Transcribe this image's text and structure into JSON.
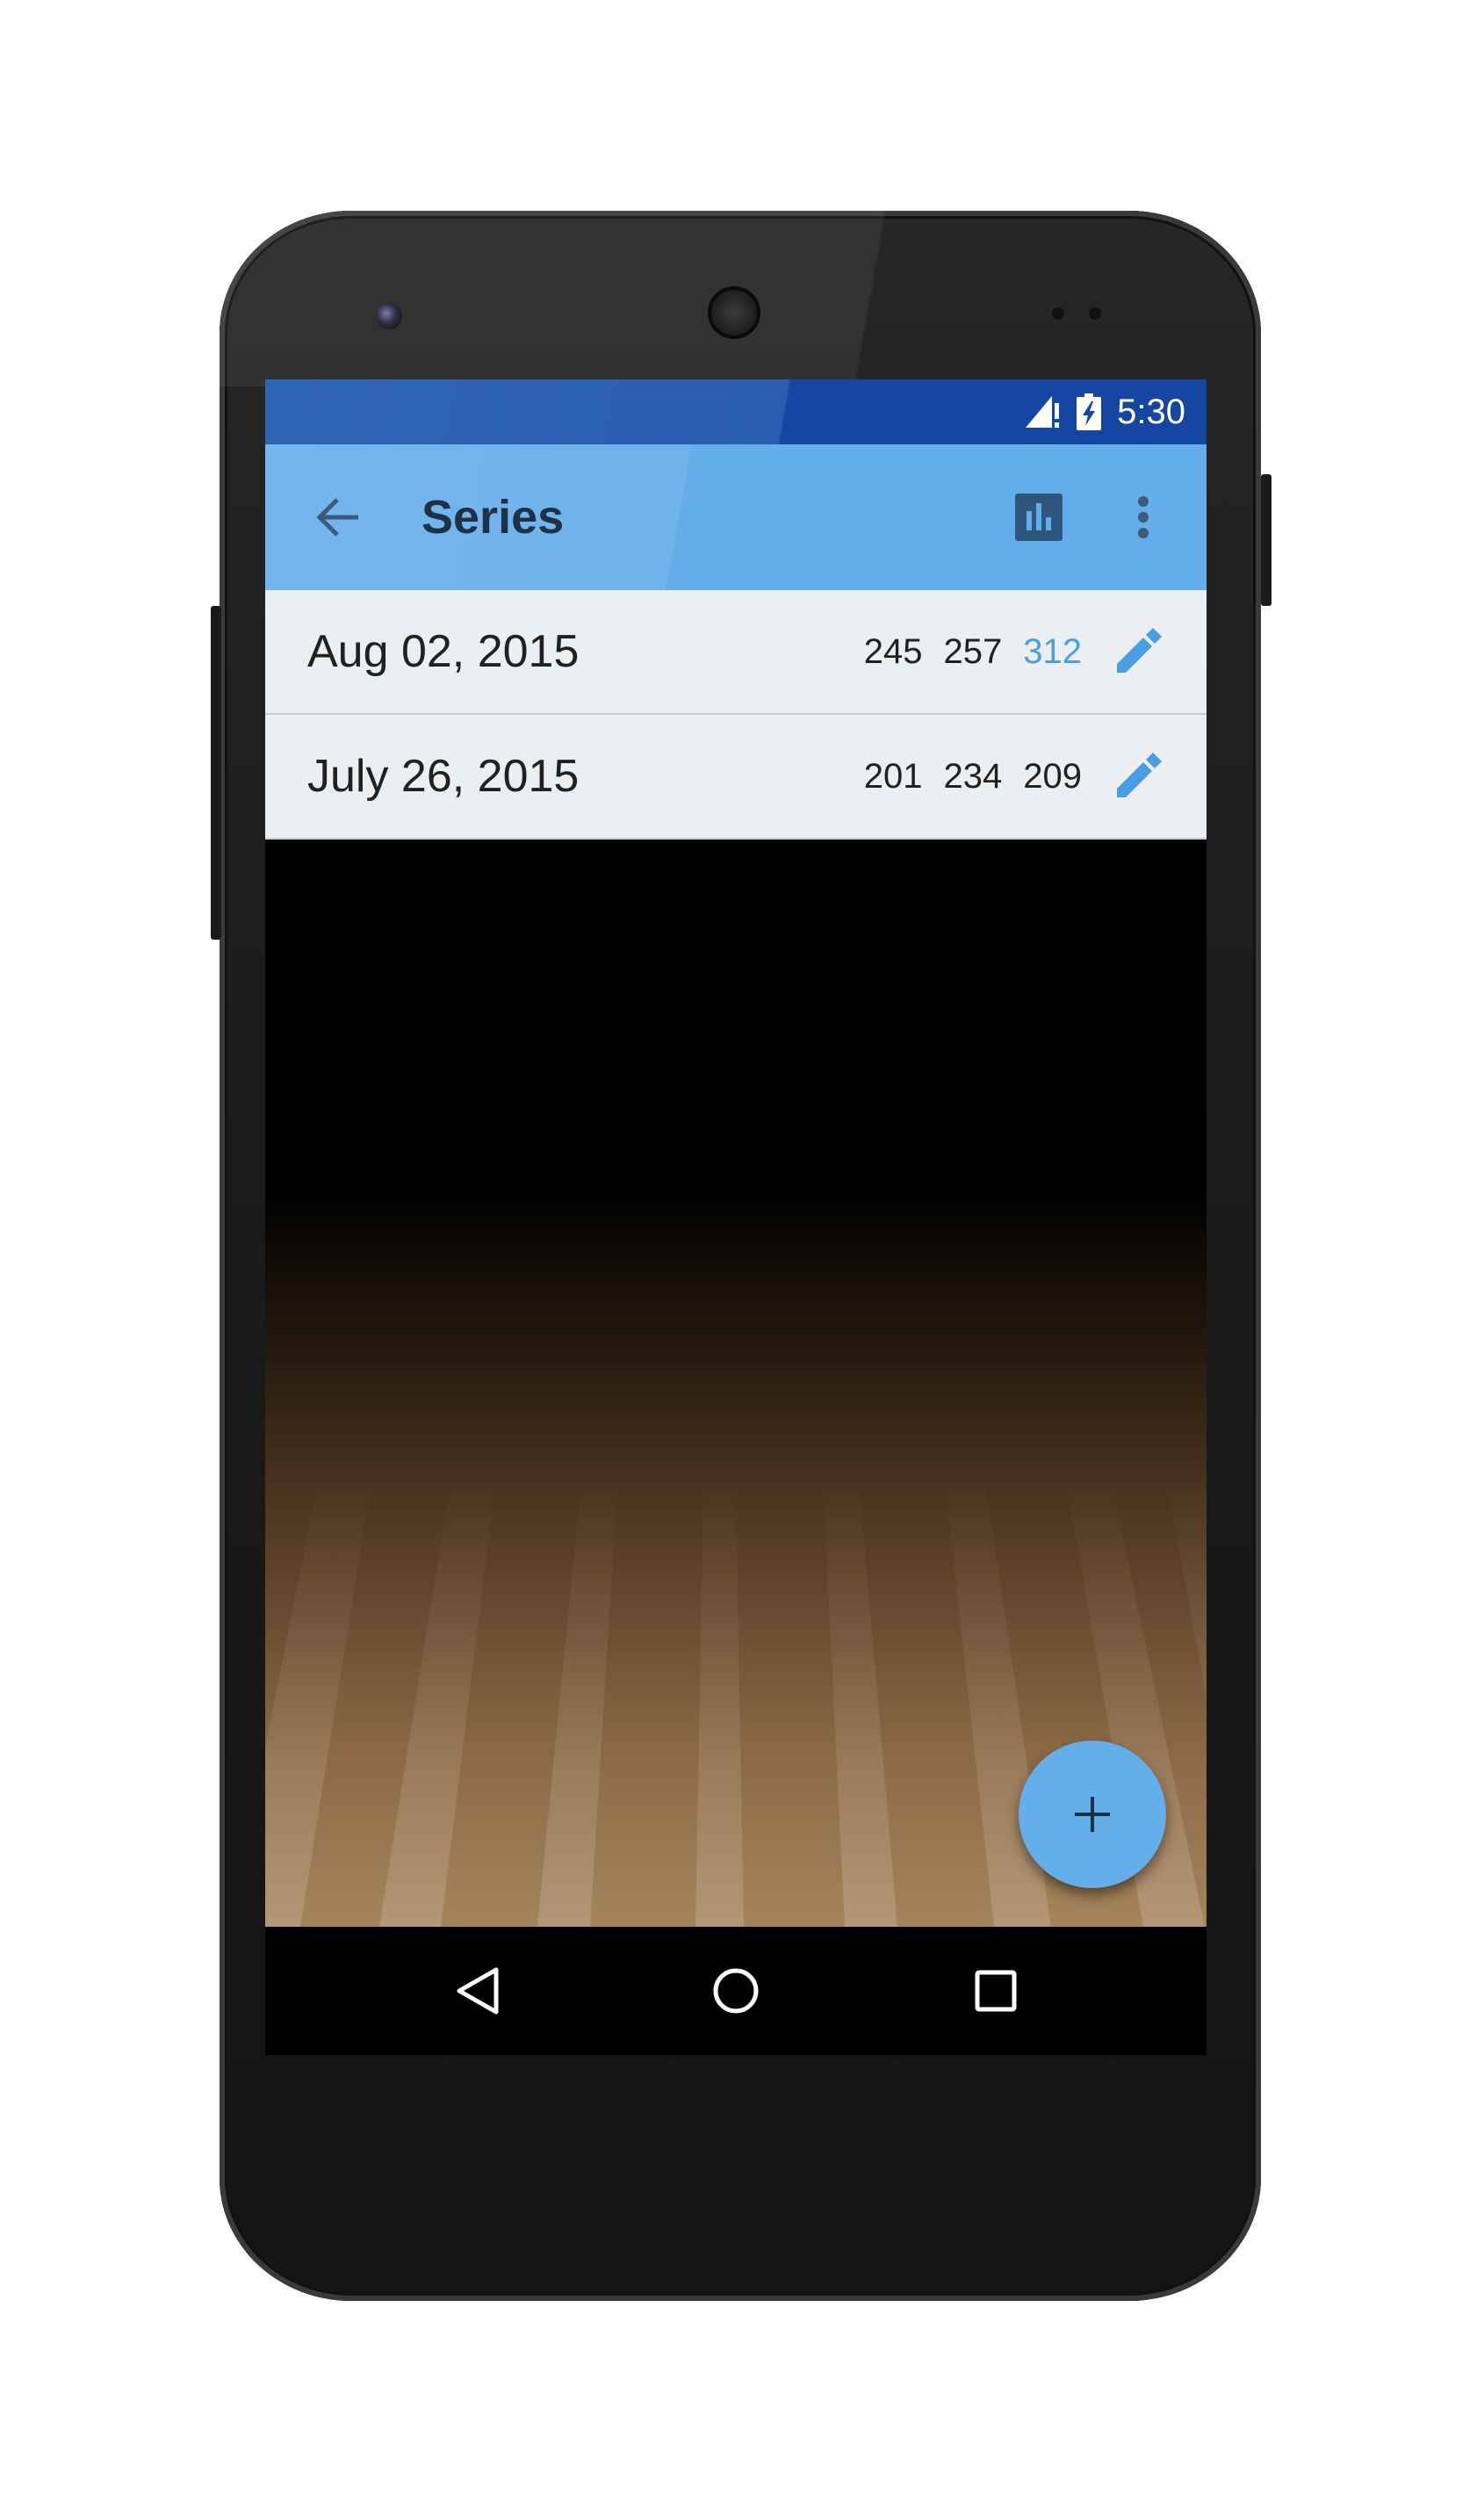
{
  "status_bar": {
    "time": "5:30",
    "icons": [
      "signal-icon",
      "battery-charging-icon"
    ]
  },
  "app_bar": {
    "title": "Series",
    "back_icon": "arrow-back-icon",
    "chart_icon": "bar-chart-icon",
    "menu_icon": "more-vertical-icon"
  },
  "series": [
    {
      "date": "Aug 02, 2015",
      "scores": [
        "245",
        "257",
        "312"
      ],
      "best_index": 2
    },
    {
      "date": "July 26, 2015",
      "scores": [
        "201",
        "234",
        "209"
      ],
      "best_index": -1
    }
  ],
  "fab": {
    "icon": "add-icon",
    "label": "+"
  },
  "nav_bar": {
    "icons": [
      "nav-back-icon",
      "nav-home-icon",
      "nav-recent-apps-icon"
    ]
  },
  "colors": {
    "app_bar": "#63adea",
    "status_bar": "#1446a2",
    "accent": "#4a9ee2",
    "row_background": "#eceff1",
    "title_text": "#1f3146"
  }
}
